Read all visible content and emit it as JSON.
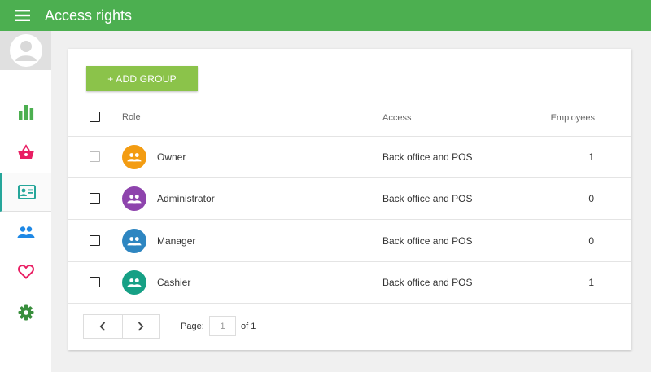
{
  "colors": {
    "topbar": "#4caf50",
    "add_button": "#8bc34a",
    "active_accent": "#26a69a"
  },
  "header": {
    "menu_icon": "hamburger-icon",
    "title": "Access rights"
  },
  "sidebar": {
    "avatar_icon": "user-avatar-icon",
    "items": [
      {
        "icon": "bar-chart-icon",
        "color": "#4caf50",
        "active": false
      },
      {
        "icon": "basket-icon",
        "color": "#e91e63",
        "active": false
      },
      {
        "icon": "id-card-icon",
        "color": "#26a69a",
        "active": true
      },
      {
        "icon": "people-icon",
        "color": "#1e88e5",
        "active": false
      },
      {
        "icon": "heart-icon",
        "color": "#e91e63",
        "active": false
      },
      {
        "icon": "gear-icon",
        "color": "#388e3c",
        "active": false
      }
    ]
  },
  "main": {
    "add_button_label": "+ ADD GROUP",
    "columns": {
      "role": "Role",
      "access": "Access",
      "employees": "Employees"
    },
    "rows": [
      {
        "role": "Owner",
        "access": "Back office and POS",
        "employees": "1",
        "icon_color": "#f39c12",
        "checkbox_disabled": true
      },
      {
        "role": "Administrator",
        "access": "Back office and POS",
        "employees": "0",
        "icon_color": "#8e44ad",
        "checkbox_disabled": false
      },
      {
        "role": "Manager",
        "access": "Back office and POS",
        "employees": "0",
        "icon_color": "#2e86c1",
        "checkbox_disabled": false
      },
      {
        "role": "Cashier",
        "access": "Back office and POS",
        "employees": "1",
        "icon_color": "#16a085",
        "checkbox_disabled": false
      }
    ],
    "pagination": {
      "page_label": "Page:",
      "page_value": "1",
      "of_label": "of 1",
      "prev_icon": "chevron-left-icon",
      "next_icon": "chevron-right-icon"
    }
  }
}
